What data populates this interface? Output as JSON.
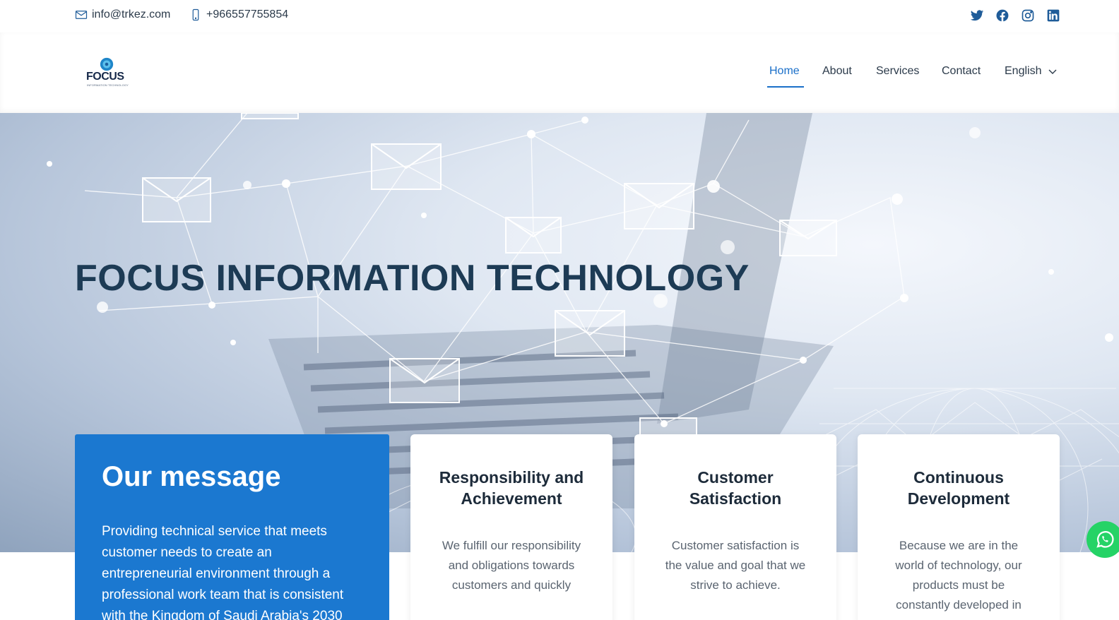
{
  "topbar": {
    "email": "info@trkez.com",
    "phone": "+966557755854",
    "social": [
      "twitter-icon",
      "facebook-icon",
      "instagram-icon",
      "linkedin-icon"
    ]
  },
  "header": {
    "logo_word": "FOCUS",
    "logo_sub": "INFORMATION TECHNOLOGY",
    "nav": {
      "home": "Home",
      "about": "About",
      "services": "Services",
      "contact": "Contact",
      "language": "English"
    }
  },
  "hero": {
    "title": "FOCUS INFORMATION TECHNOLOGY"
  },
  "message": {
    "title": "Our message",
    "text": "Providing technical service that meets customer needs to create an entrepreneurial environment through a professional work team that is consistent with the Kingdom of Saudi Arabia's 2030"
  },
  "cards": [
    {
      "title": "Responsibility and Achievement",
      "text": "We fulfill our responsibility and obligations towards customers and quickly"
    },
    {
      "title": "Customer Satisfaction",
      "text": "Customer satisfaction is the value and goal that we strive to achieve."
    },
    {
      "title": "Continuous Development",
      "text": "Because we are in the world of technology, our products must be constantly developed in"
    }
  ],
  "colors": {
    "accent": "#1a6fc9",
    "card_blue": "#1b78d0",
    "hero_title": "#1d3b55",
    "whatsapp": "#25d366"
  }
}
